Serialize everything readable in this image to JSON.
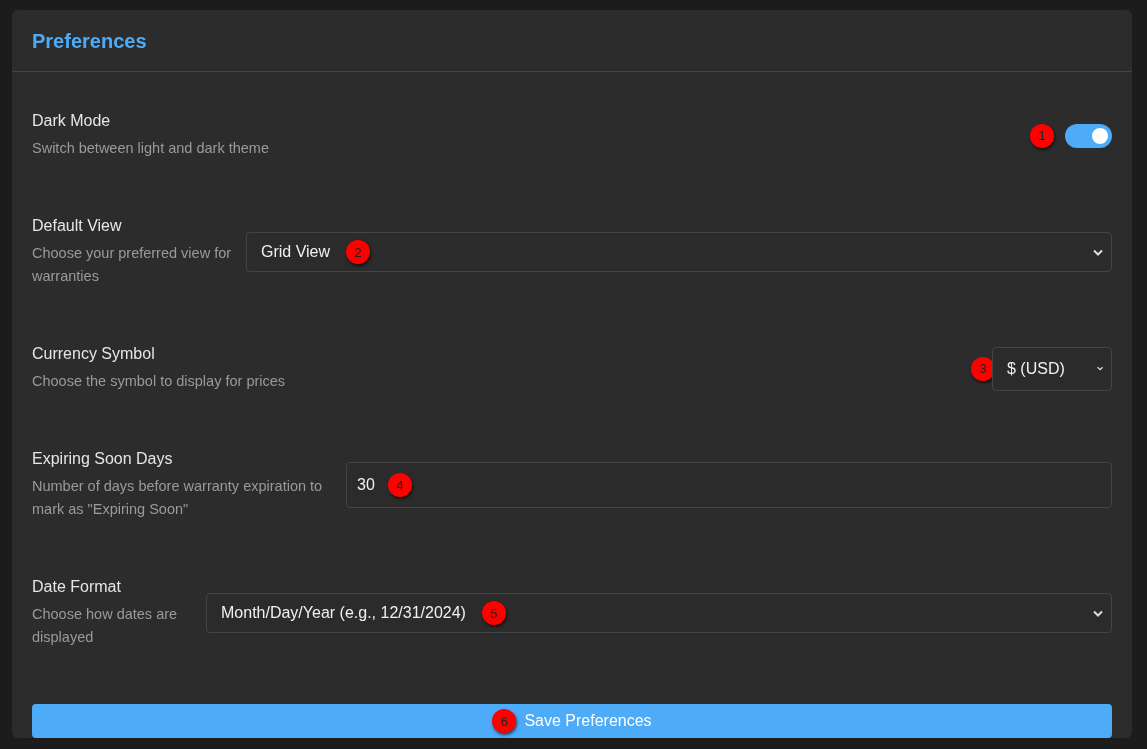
{
  "panel": {
    "title": "Preferences"
  },
  "settings": [
    {
      "kind": "toggle",
      "label": "Dark Mode",
      "description": "Switch between light and dark theme",
      "on": true,
      "marker": "1"
    },
    {
      "kind": "select",
      "label": "Default View",
      "description": "Choose your preferred view for warranties",
      "value": "Grid View",
      "marker": "2"
    },
    {
      "kind": "select_compact",
      "label": "Currency Symbol",
      "description": "Choose the symbol to display for prices",
      "value": "$ (USD)",
      "marker": "3"
    },
    {
      "kind": "input",
      "label": "Expiring Soon Days",
      "description": "Number of days before warranty expiration to mark as \"Expiring Soon\"",
      "value": "30",
      "marker": "4"
    },
    {
      "kind": "select",
      "label": "Date Format",
      "description": "Choose how dates are displayed",
      "value": "Month/Day/Year (e.g., 12/31/2024)",
      "marker": "5"
    }
  ],
  "save_button": {
    "label": "Save Preferences",
    "marker": "6"
  }
}
